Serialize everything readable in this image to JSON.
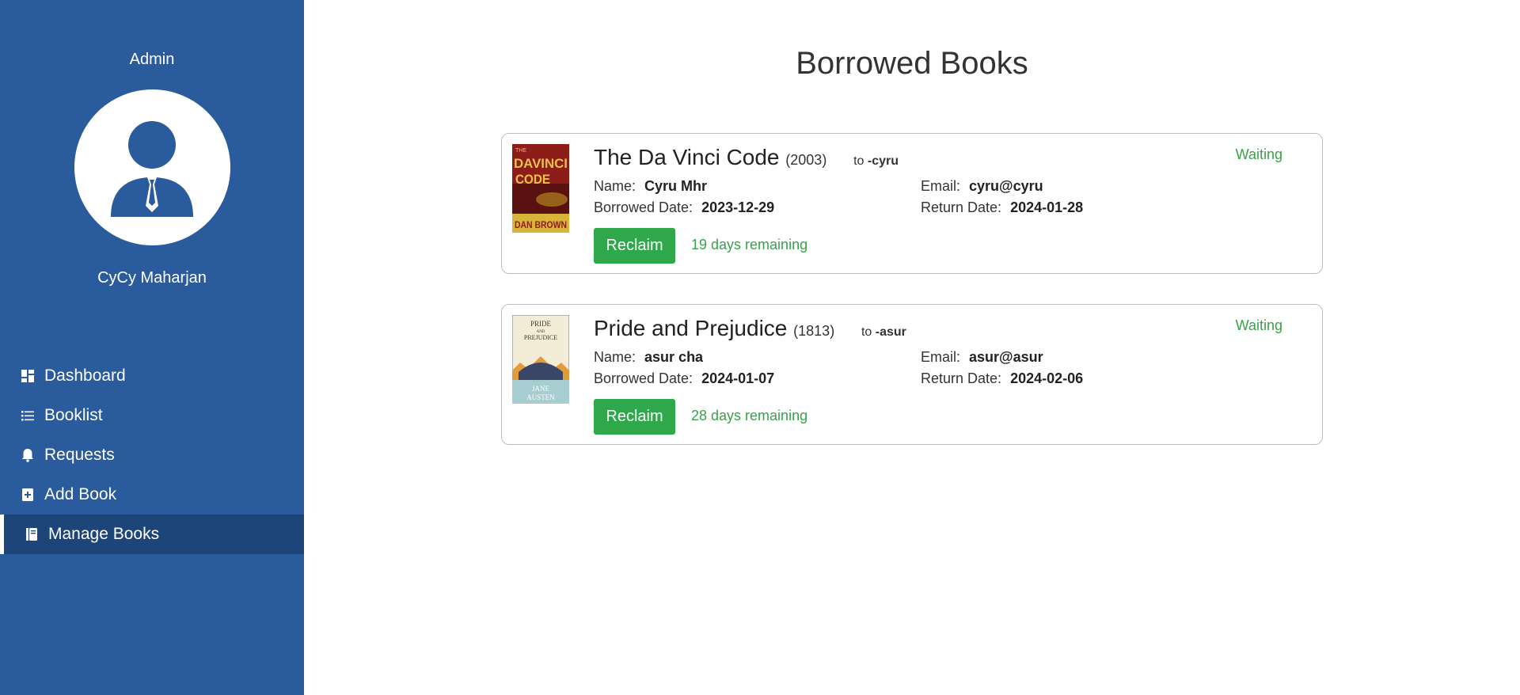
{
  "sidebar": {
    "role": "Admin",
    "username": "CyCy Maharjan",
    "items": [
      {
        "label": "Dashboard",
        "icon": "dashboard-icon"
      },
      {
        "label": "Booklist",
        "icon": "list-icon"
      },
      {
        "label": "Requests",
        "icon": "bell-icon"
      },
      {
        "label": "Add Book",
        "icon": "add-book-icon"
      },
      {
        "label": "Manage Books",
        "icon": "book-icon",
        "active": true
      }
    ]
  },
  "main": {
    "title": "Borrowed Books",
    "cards": [
      {
        "title": "The Da Vinci Code",
        "year": "(2003)",
        "to_prefix": "to",
        "to_user": "-cyru",
        "status": "Waiting",
        "name_label": "Name:",
        "name": "Cyru Mhr",
        "email_label": "Email:",
        "email": "cyru@cyru",
        "borrowed_label": "Borrowed Date:",
        "borrowed": "2023-12-29",
        "return_label": "Return Date:",
        "return": "2024-01-28",
        "button": "Reclaim",
        "remaining": "19 days remaining",
        "cover_text": [
          "THE",
          "DAVINCI",
          "CODE",
          "DAN BROWN"
        ]
      },
      {
        "title": "Pride and Prejudice",
        "year": "(1813)",
        "to_prefix": "to",
        "to_user": "-asur",
        "status": "Waiting",
        "name_label": "Name:",
        "name": "asur cha",
        "email_label": "Email:",
        "email": "asur@asur",
        "borrowed_label": "Borrowed Date:",
        "borrowed": "2024-01-07",
        "return_label": "Return Date:",
        "return": "2024-02-06",
        "button": "Reclaim",
        "remaining": "28 days remaining",
        "cover_text": [
          "PRIDE",
          "AND",
          "PREJUDICE",
          "JANE",
          "AUSTEN"
        ]
      }
    ]
  },
  "colors": {
    "sidebar": "#2a5b9d",
    "sidebar_active": "#1e4579",
    "accent_green": "#2ea84a",
    "status_green": "#3aa14a"
  }
}
